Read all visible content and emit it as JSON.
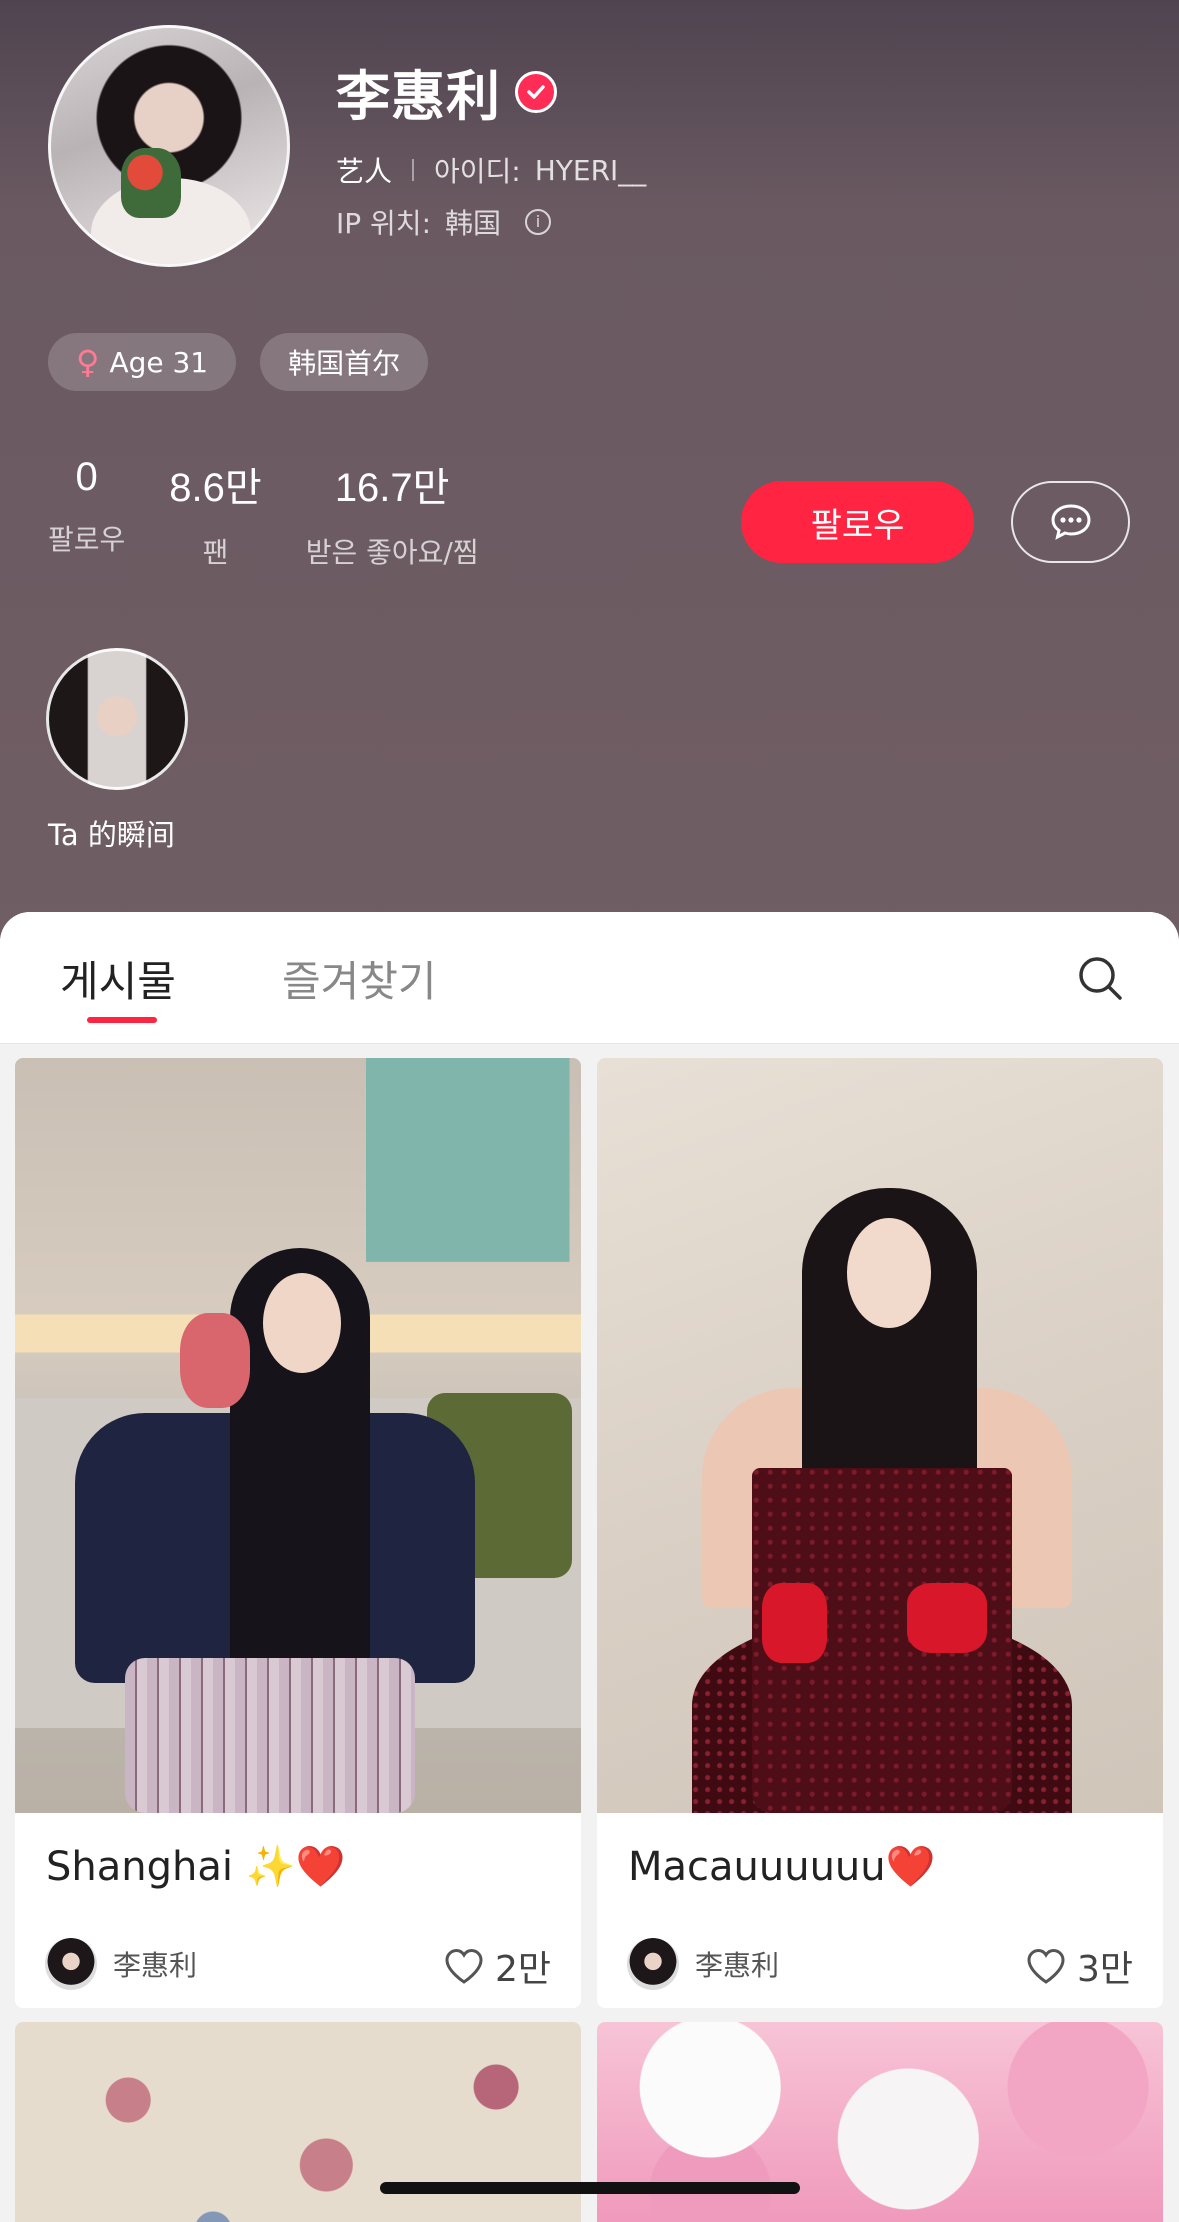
{
  "profile": {
    "name": "李惠利",
    "role": "艺人",
    "id_label": "아이디:",
    "id_value": "HYERI__",
    "ip_label": "IP 위치:",
    "ip_value": "韩国",
    "tags": {
      "age": "Age 31",
      "location": "韩国首尔"
    },
    "stats": {
      "following_value": "0",
      "following_label": "팔로우",
      "fans_value": "8.6만",
      "fans_label": "팬",
      "likes_value": "16.7만",
      "likes_label": "받은 좋아요/찜"
    },
    "follow_button": "팔로우",
    "moment_label": "Ta 的瞬间"
  },
  "tabs": {
    "posts": "게시물",
    "favorites": "즐겨찾기"
  },
  "posts": [
    {
      "title_text": "Shanghai ",
      "title_emoji_1": "✨",
      "title_emoji_2": "❤️",
      "author": "李惠利",
      "likes": "2만"
    },
    {
      "title_text": "Macauuuuuu",
      "title_emoji_1": "",
      "title_emoji_2": "❤️",
      "author": "李惠利",
      "likes": "3만"
    }
  ],
  "colors": {
    "accent": "#ff2442",
    "header_bg": "#6f5e63",
    "verified": "#ff2d55"
  },
  "icons": [
    "verified-icon",
    "info-icon",
    "female-icon",
    "chat-icon",
    "search-icon",
    "heart-icon"
  ]
}
